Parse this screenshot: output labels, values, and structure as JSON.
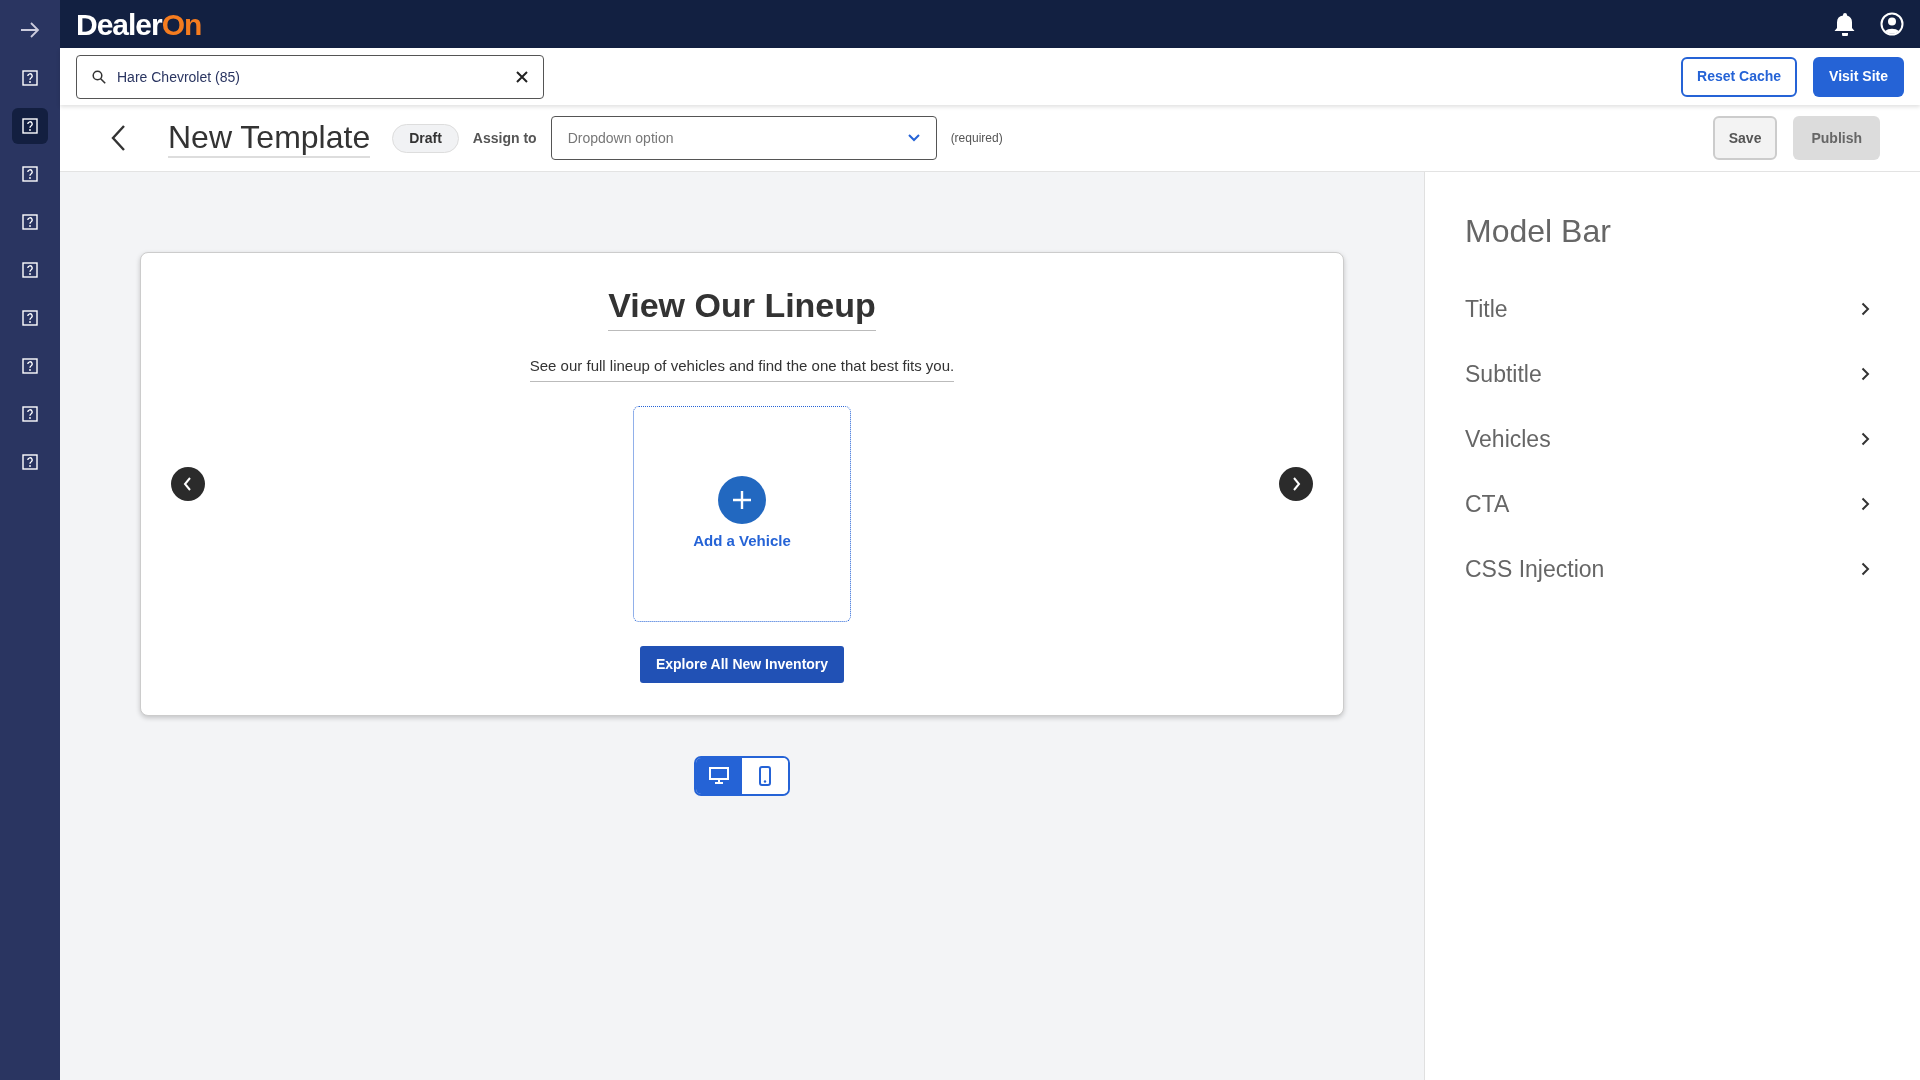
{
  "sidebar": {
    "items": [
      {
        "kind": "arrow",
        "selected": false
      },
      {
        "kind": "help",
        "selected": false
      },
      {
        "kind": "help",
        "selected": true
      },
      {
        "kind": "help",
        "selected": false
      },
      {
        "kind": "help",
        "selected": false
      },
      {
        "kind": "help",
        "selected": false
      },
      {
        "kind": "help",
        "selected": false
      },
      {
        "kind": "help",
        "selected": false
      },
      {
        "kind": "help",
        "selected": false
      },
      {
        "kind": "help",
        "selected": false
      }
    ]
  },
  "topbar": {
    "logo": {
      "text": "Dealer",
      "accent": "On"
    }
  },
  "search": {
    "value": "Hare Chevrolet (85)"
  },
  "actions": [
    {
      "label": "Reset Cache",
      "kind": "outline"
    },
    {
      "label": "Visit Site",
      "kind": "primary"
    }
  ],
  "header": {
    "title": "New Template",
    "status": "Draft",
    "assign_label": "Assign to",
    "assign_placeholder": "Dropdown option",
    "required_note": "(required)",
    "buttons": [
      {
        "label": "Save",
        "disabled": false
      },
      {
        "label": "Publish",
        "disabled": true
      }
    ]
  },
  "preview": {
    "title": "View Our Lineup",
    "subtitle": "See our full lineup of vehicles and find the one that best fits you.",
    "add_label": "Add a Vehicle",
    "cta": "Explore All New Inventory"
  },
  "view_toggle": [
    {
      "kind": "desktop",
      "selected": true
    },
    {
      "kind": "mobile",
      "selected": false
    }
  ],
  "panel": {
    "title": "Model Bar",
    "items": [
      "Title",
      "Subtitle",
      "Vehicles",
      "CTA",
      "CSS Injection"
    ]
  }
}
